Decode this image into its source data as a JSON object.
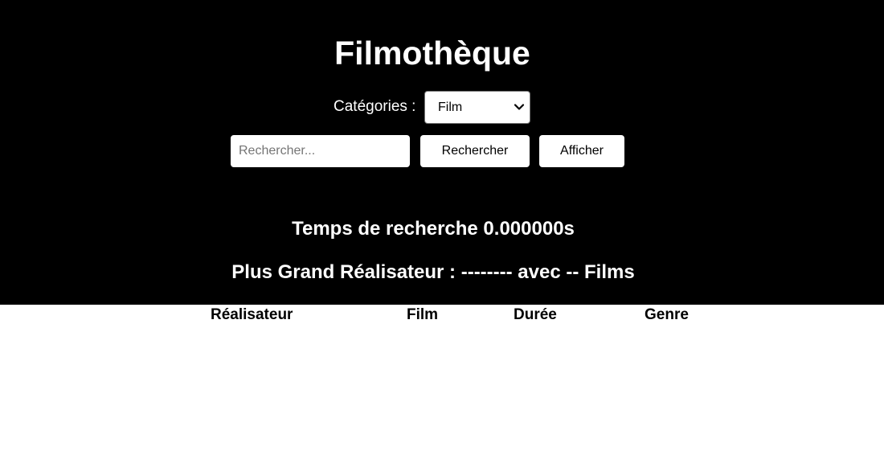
{
  "header": {
    "title": "Filmothèque"
  },
  "filters": {
    "category_label": "Catégories :",
    "category_selected": "Film"
  },
  "search": {
    "placeholder": "Rechercher...",
    "value": "",
    "search_button": "Rechercher",
    "show_button": "Afficher"
  },
  "stats": {
    "search_time": "Temps de recherche 0.000000s",
    "top_director": "Plus Grand Réalisateur : -------- avec -- Films"
  },
  "table": {
    "columns": [
      "Réalisateur",
      "Film",
      "Durée",
      "Genre"
    ],
    "rows": []
  },
  "colors": {
    "header_bg": "#000000",
    "header_text": "#ffffff",
    "page_bg": "#ffffff"
  },
  "icons": {
    "select_arrow": "chevron-down-icon"
  }
}
